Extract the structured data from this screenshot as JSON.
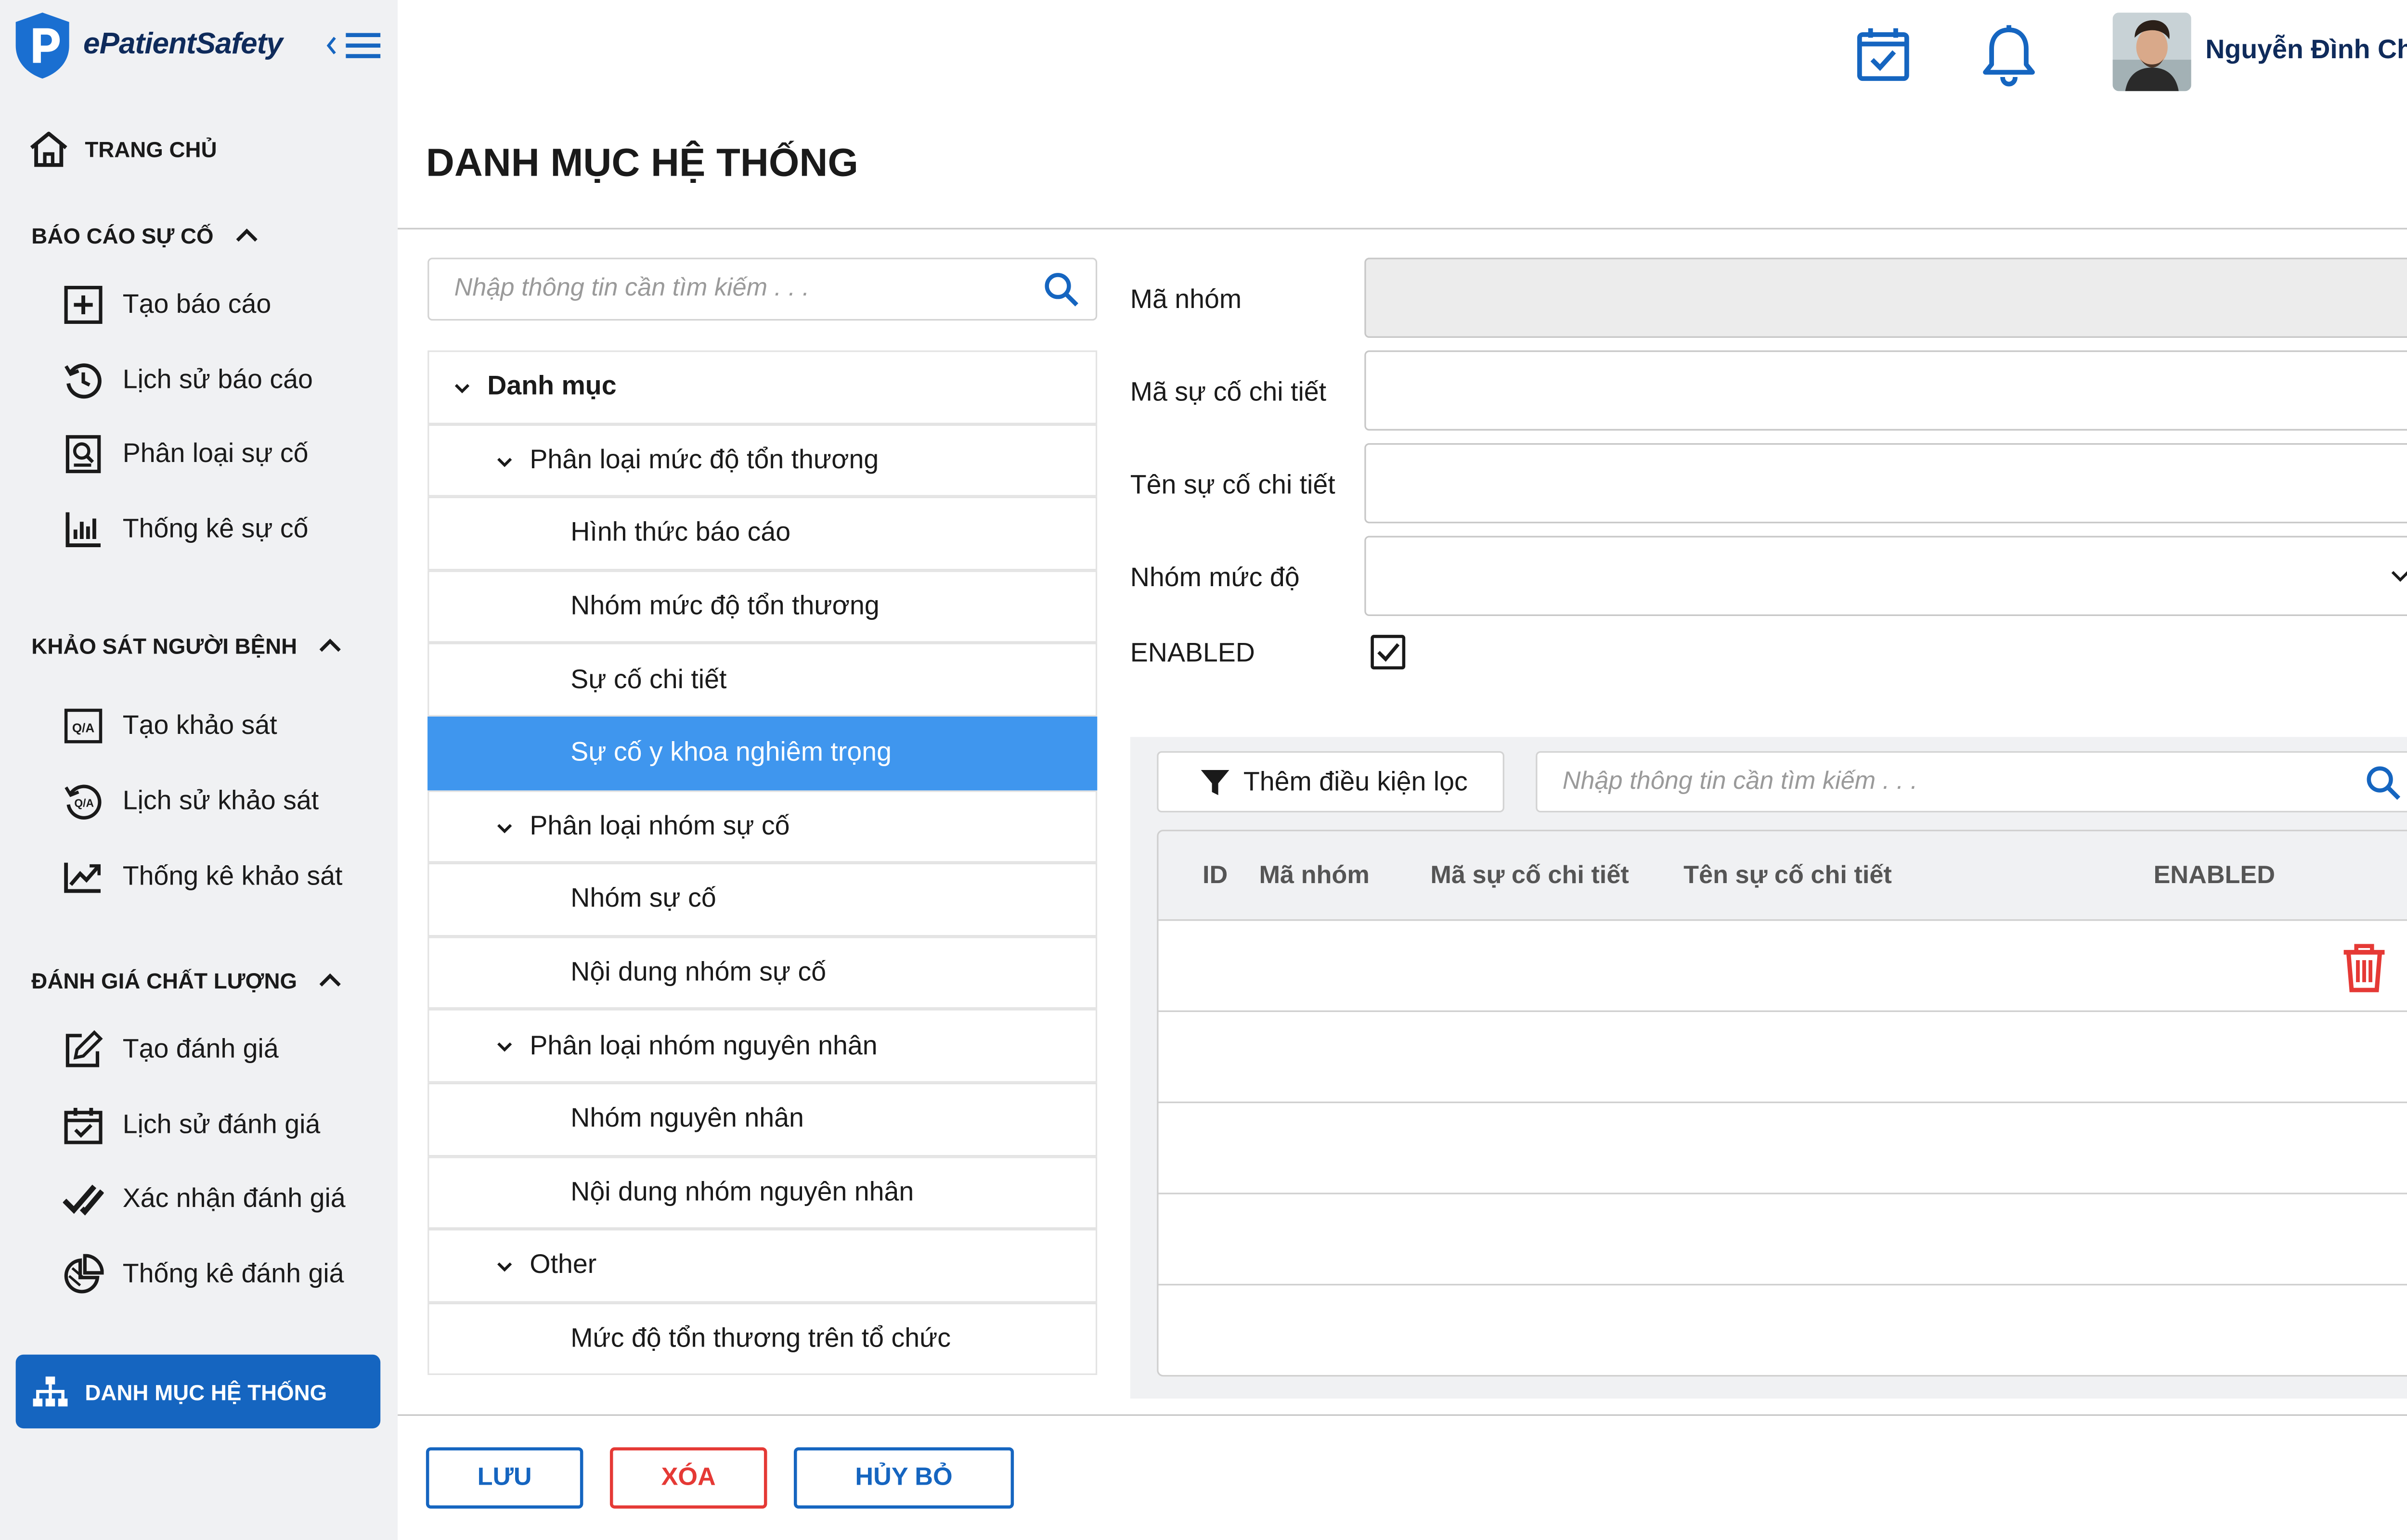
{
  "app": {
    "brand": "ePatientSafety",
    "user_name": "Nguyễn Đình Chiện",
    "page_title": "DANH MỤC HỆ THỐNG"
  },
  "colors": {
    "primary": "#1565c0",
    "active_row": "#3f96ee",
    "danger": "#e53935",
    "sidebar_bg": "#f0f1f3"
  },
  "sidebar": {
    "home": {
      "label": "TRANG CHỦ",
      "icon": "home-icon"
    },
    "sections": [
      {
        "title": "BÁO CÁO SỰ CỐ",
        "items": [
          {
            "label": "Tạo báo cáo",
            "icon": "plus-square-icon"
          },
          {
            "label": "Lịch sử báo cáo",
            "icon": "history-icon"
          },
          {
            "label": "Phân loại sự cố",
            "icon": "classify-icon"
          },
          {
            "label": "Thống kê sự cố",
            "icon": "bar-chart-icon"
          }
        ]
      },
      {
        "title": "KHẢO SÁT NGƯỜI BỆNH",
        "items": [
          {
            "label": "Tạo khảo sát",
            "icon": "qa-icon"
          },
          {
            "label": "Lịch sử khảo sát",
            "icon": "qa-history-icon"
          },
          {
            "label": "Thống kê khảo sát",
            "icon": "trend-chart-icon"
          }
        ]
      },
      {
        "title": "ĐÁNH GIÁ CHẤT LƯỢNG",
        "items": [
          {
            "label": "Tạo đánh giá",
            "icon": "edit-icon"
          },
          {
            "label": "Lịch sử đánh giá",
            "icon": "calendar-check-icon"
          },
          {
            "label": "Xác nhận đánh giá",
            "icon": "double-check-icon"
          },
          {
            "label": "Thống kê đánh giá",
            "icon": "pie-chart-icon"
          }
        ]
      }
    ],
    "active": {
      "label": "DANH MỤC HỆ THỐNG",
      "icon": "sitemap-icon"
    }
  },
  "tree_search": {
    "placeholder": "Nhập thông tin cần tìm kiếm . . ."
  },
  "tree": [
    {
      "label": "Danh mục",
      "level": 0,
      "expanded": true
    },
    {
      "label": "Phân loại mức độ tổn thương",
      "level": 1,
      "expanded": true
    },
    {
      "label": "Hình thức báo cáo",
      "level": 2
    },
    {
      "label": "Nhóm mức độ tổn thương",
      "level": 2
    },
    {
      "label": "Sự cố chi tiết",
      "level": 2
    },
    {
      "label": "Sự cố y khoa nghiêm trọng",
      "level": 2,
      "active": true
    },
    {
      "label": "Phân loại nhóm sự cố",
      "level": 1,
      "expanded": true
    },
    {
      "label": "Nhóm sự cố",
      "level": 2
    },
    {
      "label": "Nội dung nhóm sự cố",
      "level": 2
    },
    {
      "label": "Phân loại nhóm nguyên nhân",
      "level": 1,
      "expanded": true
    },
    {
      "label": "Nhóm nguyên nhân",
      "level": 2
    },
    {
      "label": "Nội dung nhóm nguyên nhân",
      "level": 2
    },
    {
      "label": "Other",
      "level": 1,
      "expanded": true
    },
    {
      "label": "Mức độ tổn thương trên tổ chức",
      "level": 2
    }
  ],
  "form": {
    "group_code": {
      "label": "Mã nhóm",
      "value": ""
    },
    "detail_code": {
      "label": "Mã sự cố chi tiết",
      "value": ""
    },
    "detail_name": {
      "label": "Tên sự cố chi tiết",
      "value": ""
    },
    "severity_group": {
      "label": "Nhóm mức độ",
      "value": ""
    },
    "enabled": {
      "label": "ENABLED",
      "checked": true
    }
  },
  "grid": {
    "filter_label": "Thêm điều kiện lọc",
    "search_placeholder": "Nhập thông tin cần tìm kiếm . . .",
    "columns": [
      "ID",
      "Mã nhóm",
      "Mã sự cố chi tiết",
      "Tên sự cố chi tiết",
      "ENABLED"
    ],
    "row_count": 5
  },
  "actions": {
    "save": "LƯU",
    "delete": "XÓA",
    "cancel": "HỦY BỎ"
  }
}
